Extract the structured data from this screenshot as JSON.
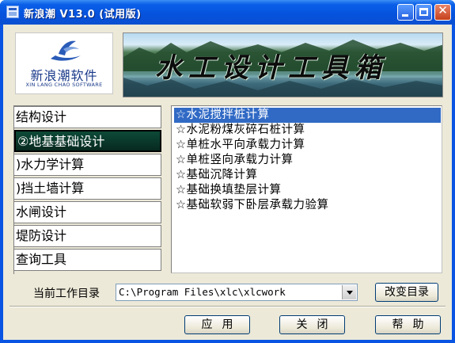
{
  "window": {
    "title": "新浪潮 V13.0 (试用版)"
  },
  "logo": {
    "name_cn": "新浪潮软件",
    "name_en": "XIN LANG CHAO SOFTWARE"
  },
  "banner": {
    "title": "水工设计工具箱"
  },
  "menu": {
    "items": [
      {
        "label": "结构设计"
      },
      {
        "label": "②地基基础设计"
      },
      {
        "label": ")水力学计算"
      },
      {
        "label": ")挡土墙计算"
      },
      {
        "label": "水闸设计"
      },
      {
        "label": "堤防设计"
      },
      {
        "label": "查询工具"
      }
    ],
    "selected_index": 1
  },
  "list": {
    "items": [
      {
        "label": "☆水泥搅拌桩计算"
      },
      {
        "label": "☆水泥粉煤灰碎石桩计算"
      },
      {
        "label": "☆单桩水平向承载力计算"
      },
      {
        "label": "☆单桩竖向承载力计算"
      },
      {
        "label": "☆基础沉降计算"
      },
      {
        "label": "☆基础换填垫层计算"
      },
      {
        "label": "☆基础软弱下卧层承载力验算"
      }
    ],
    "selected_index": 0
  },
  "workdir": {
    "label": "当前工作目录",
    "value": "C:\\Program Files\\xlc\\xlcwork",
    "change_button": "改变目录"
  },
  "buttons": {
    "apply": "应用",
    "close": "关闭",
    "help": "帮助"
  },
  "colors": {
    "titlebar": "#0a54e3",
    "menu_selected_bg": "#0a3d2e",
    "list_selected_bg": "#316ac5",
    "dialog_bg": "#ece9d8"
  }
}
